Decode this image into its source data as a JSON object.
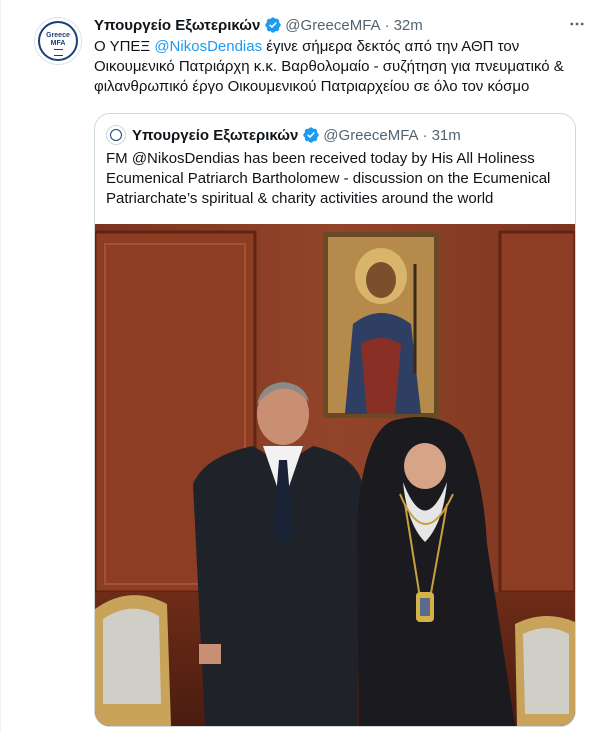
{
  "tweet": {
    "author_name": "Υπουργείο Εξωτερικών",
    "handle": "@GreeceMFA",
    "separator": "·",
    "time": "32m",
    "more_icon": "more-horizontal-icon",
    "avatar_text_line1": "Greece",
    "avatar_text_line2": "MFA",
    "text_part1": "Ο ΥΠΕΞ ",
    "mention": "@NikosDendias",
    "text_part2": " έγινε σήμερα δεκτός από την ΑΘΠ τον Οικουμενικό Πατριάρχη κ.κ. Βαρθολομαίο - συζήτηση για πνευματικό & φιλανθρωπικό έργο Οικουμενικού Πατριαρχείου σε όλο τον κόσμο"
  },
  "quoted_tweet": {
    "author_name": "Υπουργείο Εξωτερικών",
    "handle": "@GreeceMFA",
    "separator": "·",
    "time": "31m",
    "text": "FM @NikosDendias has been received today by His All Holiness Ecumenical Patriarch Bartholomew - discussion on the Ecumenical Patriarchate’s spiritual & charity activities around the world",
    "photo_icon": "photo-of-two-men-in-front-of-icon"
  },
  "colors": {
    "accent": "#1d9bf0",
    "secondary_text": "#536471",
    "border": "#cfd9de",
    "verified": "#1d9bf0",
    "wood": "#8a3e26"
  }
}
